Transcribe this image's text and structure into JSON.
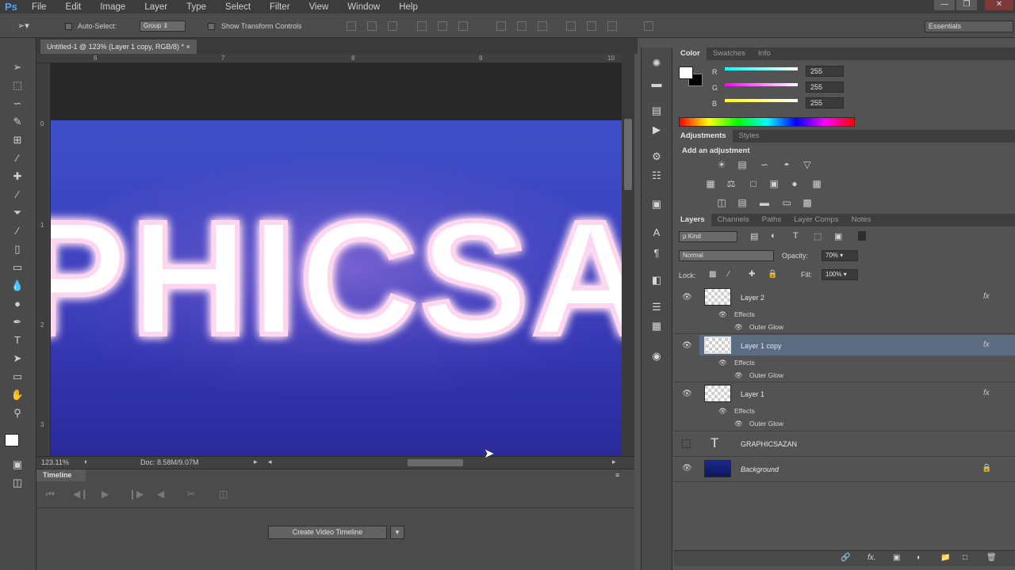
{
  "app": {
    "logo": "Ps"
  },
  "menu": [
    "File",
    "Edit",
    "Image",
    "Layer",
    "Type",
    "Select",
    "Filter",
    "View",
    "Window",
    "Help"
  ],
  "options": {
    "auto_select": "Auto-Select:",
    "auto_select_value": "Group",
    "transform_controls": "Show Transform Controls",
    "workspace": "Essentials"
  },
  "document": {
    "tab_title": "Untitled-1 @ 123% (Layer 1 copy, RGB/8) *",
    "ruler_top": [
      "6",
      "7",
      "8",
      "9",
      "10"
    ],
    "ruler_left": [
      "0",
      "1",
      "2",
      "3"
    ],
    "canvas_text": "PHICSA",
    "zoom": "123.11%",
    "doc_size": "Doc: 8.58M/9.07M"
  },
  "timeline": {
    "tab": "Timeline",
    "create_button": "Create Video Timeline"
  },
  "color_panel": {
    "tabs": [
      "Color",
      "Swatches",
      "Info"
    ],
    "channels": [
      {
        "label": "R",
        "value": "255",
        "gradient": "#00ffff,#ffffff"
      },
      {
        "label": "G",
        "value": "255",
        "gradient": "#ff00ff,#ffffff"
      },
      {
        "label": "B",
        "value": "255",
        "gradient": "#ffff00,#ffffff"
      }
    ]
  },
  "adjustments_panel": {
    "tabs": [
      "Adjustments",
      "Styles"
    ],
    "heading": "Add an adjustment"
  },
  "layers_panel": {
    "tabs": [
      "Layers",
      "Channels",
      "Paths",
      "Layer Comps",
      "Notes"
    ],
    "filter": "ρ Kind",
    "blend_mode": "Normal",
    "opacity_label": "Opacity:",
    "opacity_value": "70%",
    "lock_label": "Lock:",
    "fill_label": "Fill:",
    "fill_value": "100%",
    "layers": [
      {
        "name": "Layer 2",
        "effects": "Effects",
        "effect_item": "Outer Glow"
      },
      {
        "name": "Layer 1 copy",
        "effects": "Effects",
        "effect_item": "Outer Glow"
      },
      {
        "name": "Layer 1",
        "effects": "Effects",
        "effect_item": "Outer Glow"
      },
      {
        "name": "GRAPHICSAZAN"
      },
      {
        "name": "Background"
      }
    ]
  }
}
